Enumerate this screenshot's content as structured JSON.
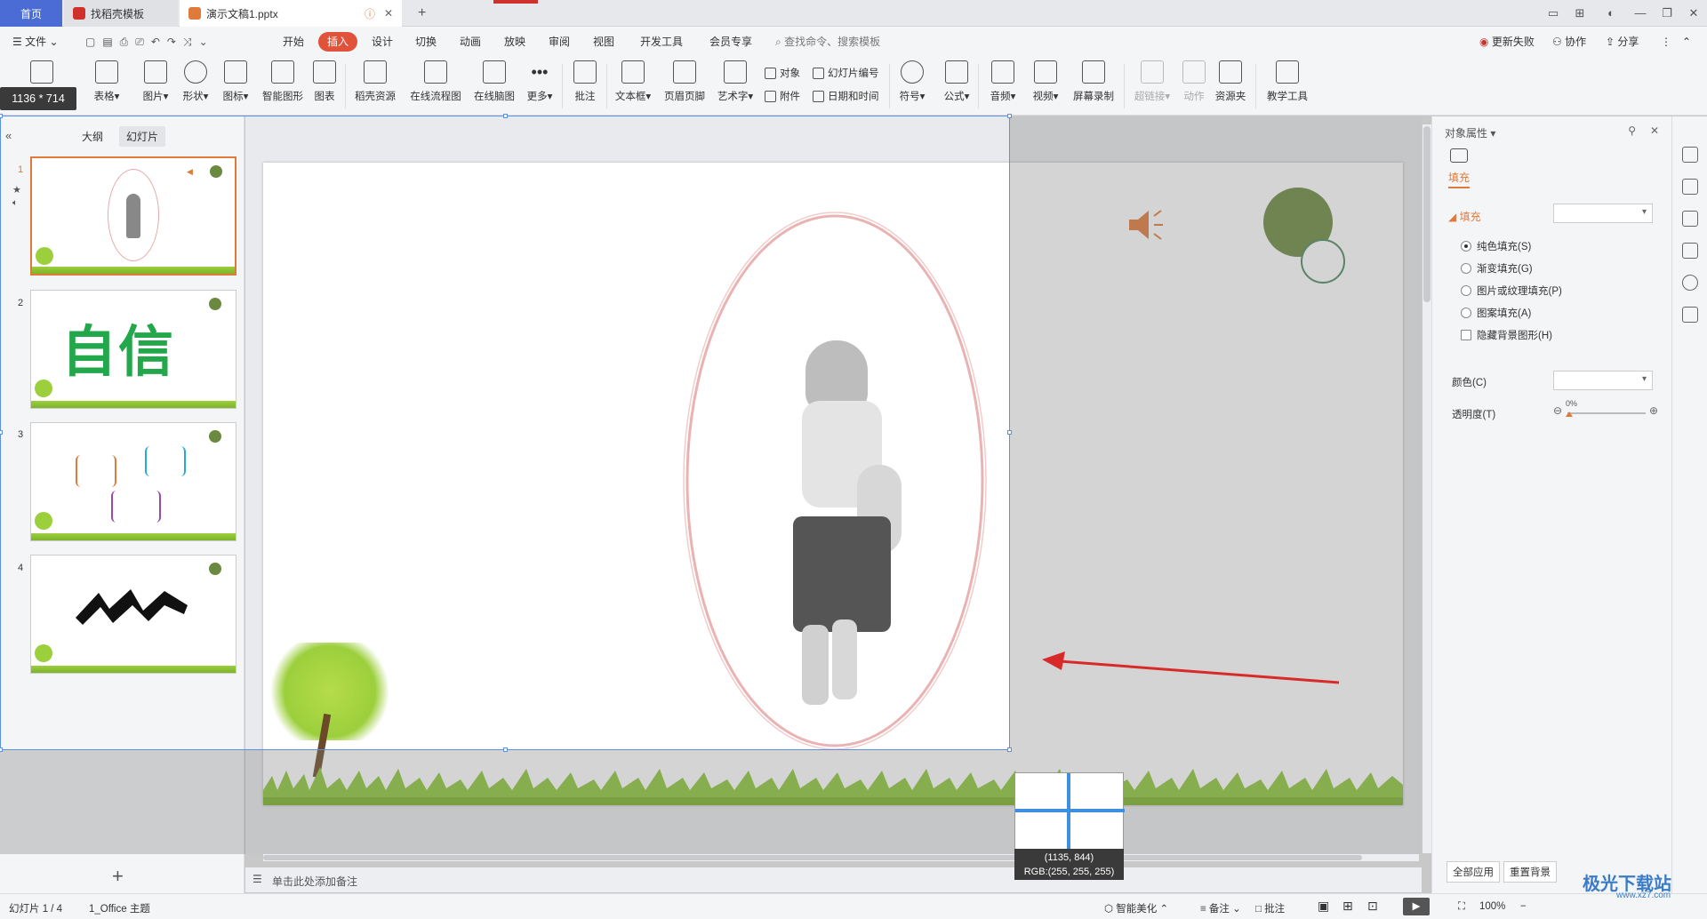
{
  "titlebar": {
    "tabs": [
      {
        "label": "首页",
        "color": "#4a6cd4"
      },
      {
        "label": "找稻壳模板",
        "color": "#d0312d"
      },
      {
        "label": "演示文稿1.pptx",
        "color": "#e07a3a"
      }
    ],
    "new_tab": "+"
  },
  "menubar": {
    "file": "文件",
    "items": [
      "开始",
      "插入",
      "设计",
      "切换",
      "动画",
      "放映",
      "审阅",
      "视图",
      "开发工具",
      "会员专享"
    ],
    "active": "插入",
    "search_placeholder": "查找命令、搜索模板",
    "right": [
      "更新失败",
      "协作",
      "分享"
    ]
  },
  "ribbon": {
    "items": [
      "表格",
      "图片",
      "形状",
      "图标",
      "智能图形",
      "图表",
      "稻壳资源",
      "在线流程图",
      "在线脑图",
      "更多",
      "批注",
      "文本框",
      "页眉页脚",
      "艺术字"
    ],
    "small_items": [
      "对象",
      "附件",
      "幻灯片编号",
      "日期和时间"
    ],
    "items2": [
      "符号",
      "公式",
      "音频",
      "视频",
      "屏幕录制",
      "超链接",
      "动作",
      "资源夹",
      "教学工具"
    ]
  },
  "size_badge": "1136 * 714",
  "leftpanel": {
    "tabs": [
      "大纲",
      "幻灯片"
    ],
    "active_tab": "幻灯片",
    "slides": [
      {
        "num": "1"
      },
      {
        "num": "2",
        "text": "自信"
      },
      {
        "num": "3"
      },
      {
        "num": "4"
      }
    ],
    "add_button": "+"
  },
  "notes_placeholder": "单击此处添加备注",
  "rightpanel": {
    "title": "对象属性",
    "tab": "填充",
    "section": "填充",
    "options": [
      "纯色填充(S)",
      "渐变填充(G)",
      "图片或纹理填充(P)",
      "图案填充(A)"
    ],
    "selected_option": 0,
    "hide_bg": "隐藏背景图形(H)",
    "color_label": "颜色(C)",
    "transparency_label": "透明度(T)",
    "transparency_value": "0%",
    "apply_all": "全部应用",
    "reset_bg": "重置背景"
  },
  "magnifier": {
    "coords": "(1135, 844)",
    "rgb": "RGB:(255, 255, 255)"
  },
  "statusbar": {
    "slide_info": "幻灯片 1 / 4",
    "theme": "1_Office 主题",
    "beautify": "智能美化",
    "notes": "备注",
    "comments": "批注",
    "zoom": "100%"
  },
  "watermark": "极光下载站",
  "watermark_url": "www.xz7.com",
  "colors": {
    "accent": "#e07a3a",
    "active_menu": "#e0533a",
    "selection": "#5c8fe6",
    "arrow": "#d92a2a",
    "green_circle": "#6b8a3f"
  }
}
